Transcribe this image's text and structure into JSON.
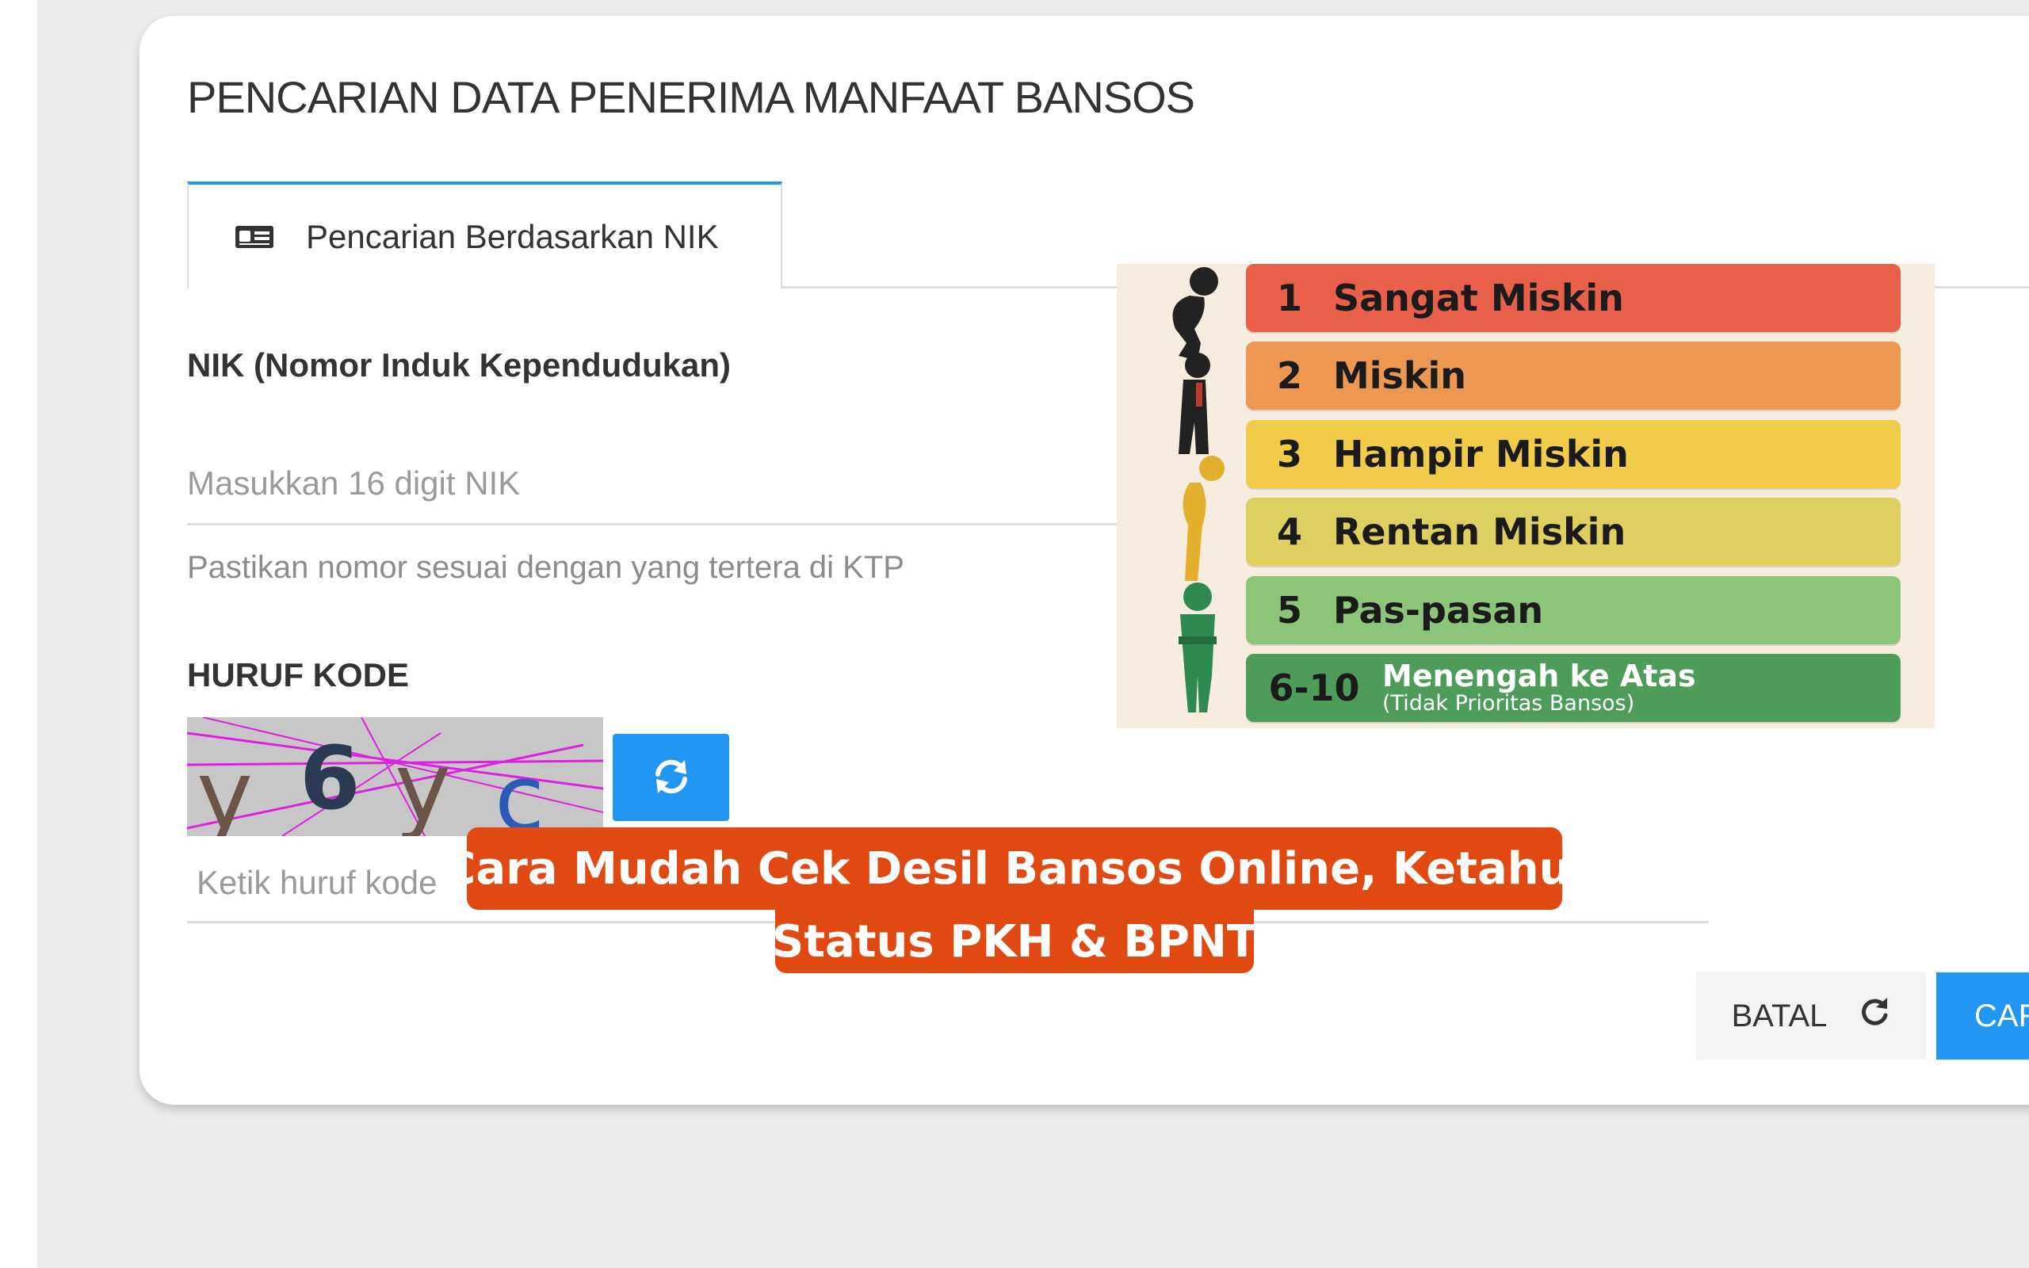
{
  "page": {
    "title": "PENCARIAN DATA PENERIMA MANFAAT BANSOS"
  },
  "tab": {
    "label": "Pencarian Berdasarkan NIK",
    "icon": "id-card-icon"
  },
  "nik": {
    "label": "NIK (Nomor Induk Kependudukan)",
    "placeholder": "Masukkan 16 digit NIK",
    "help": "Pastikan nomor sesuai dengan yang tertera di KTP"
  },
  "captcha": {
    "label": "HURUF KODE",
    "chars": [
      "y",
      "6",
      "y",
      "c"
    ],
    "refresh_icon": "refresh-icon",
    "input_placeholder": "Ketik huruf kode"
  },
  "buttons": {
    "cancel": "BATAL",
    "cancel_icon": "reset-icon",
    "search": "CARI"
  },
  "desil": {
    "rows": [
      {
        "num": "1",
        "label": "Sangat Miskin",
        "color": "#e9604a"
      },
      {
        "num": "2",
        "label": "Miskin",
        "color": "#ec9853"
      },
      {
        "num": "3",
        "label": "Hampir Miskin",
        "color": "#f1cb4a"
      },
      {
        "num": "4",
        "label": "Rentan Miskin",
        "color": "#ddd060"
      },
      {
        "num": "5",
        "label": "Pas-pasan",
        "color": "#8cc57a"
      },
      {
        "num": "6-10",
        "label": "Menengah ke Atas",
        "note": "(Tidak Prioritas Bansos)",
        "color": "#4e9c5a"
      }
    ]
  },
  "banner": {
    "line1": "Cara Mudah Cek Desil Bansos Online, Ketahui",
    "line2": "Status PKH & BPNT",
    "color": "#e04a12"
  },
  "colors": {
    "accent": "#2196f3",
    "background": "#ececec"
  }
}
